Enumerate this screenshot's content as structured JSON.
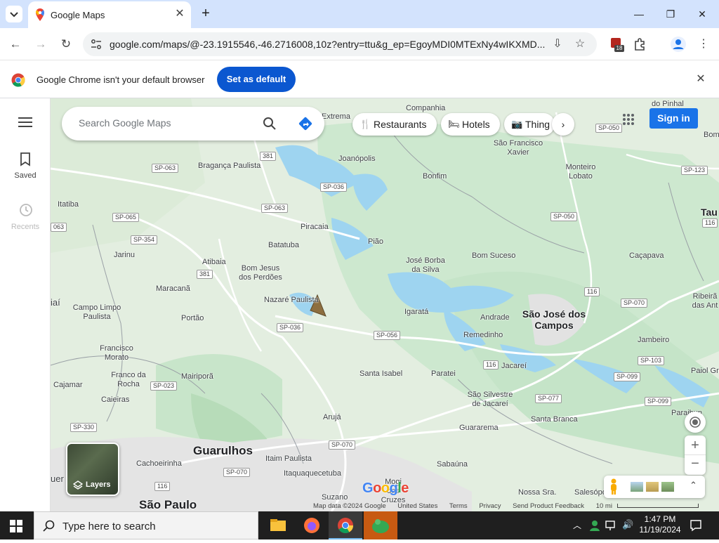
{
  "browser": {
    "tab_title": "Google Maps",
    "url": "google.com/maps/@-23.1915546,-46.2716008,10z?entry=ttu&g_ep=EgoyMDI0MTExNy4wIKXMD...",
    "extension_badge": "18",
    "infobar_message": "Google Chrome isn't your default browser",
    "set_default_label": "Set as default"
  },
  "rail": {
    "saved_label": "Saved",
    "recents_label": "Recents"
  },
  "maps": {
    "search_placeholder": "Search Google Maps",
    "chips": [
      "Restaurants",
      "Hotels",
      "Thing"
    ],
    "sign_in": "Sign in",
    "layers_label": "Layers",
    "footer": [
      "Map data ©2024 Google",
      "United States",
      "Terms",
      "Privacy",
      "Send Product Feedback",
      "10 mi"
    ],
    "places": {
      "braganca": "Bragança Paulista",
      "joanopolis": "Joanópolis",
      "companhia": "Companhia",
      "extrema": "Extrema",
      "piracaia": "Piracaia",
      "pinhal": "do Pinhal",
      "sao_francisco": "São Francisco Xavier",
      "bonfim": "Bonfim",
      "monteiro": "Monteiro Lobato",
      "itatiba": "Itatiba",
      "jarinu": "Jarinu",
      "atibaia": "Atibaia",
      "batatuba": "Batatuba",
      "bom_jesus": "Bom Jesus dos Perdões",
      "piao": "Pião",
      "jose_borba": "José Borba da Silva",
      "bom_suceso": "Bom Suceso",
      "cacapava": "Caçapava",
      "maracana": "Maracanã",
      "nazare": "Nazaré Paulista",
      "campo_limpo": "Campo Limpo Paulista",
      "portao": "Portão",
      "igarata": "Igaratá",
      "andrade": "Andrade",
      "sjc": "São José dos Campos",
      "remedinho": "Remedinho",
      "jambeiro": "Jambeiro",
      "ribeiras": "Ribeirã das Ant",
      "francisco_morato": "Francisco Morato",
      "franco": "Franco da Rocha",
      "mairipora": "Mairiporã",
      "santa_isabel": "Santa Isabel",
      "paratei": "Paratei",
      "jacarei": "Jacareí",
      "paiol": "Paiol Gr",
      "cajamar": "Cajamar",
      "caieiras": "Caieiras",
      "sao_silvestre": "São Silvestre de Jacareí",
      "paraibuna": "Paraibun",
      "aruja": "Arujá",
      "santa_branca": "Santa Branca",
      "guararema": "Guararema",
      "guarulhos": "Guarulhos",
      "itaim": "Itaim Paulista",
      "cachoeirinha": "Cachoeirinha",
      "itaquaquecetuba": "Itaquaquecetuba",
      "sabauna": "Sabaúna",
      "suzano": "Suzano",
      "mogi": "Mogi das Cruzes",
      "nossa_sra": "Nossa Sra.",
      "salesopolis": "Salesópolis",
      "sao_paulo": "São Paulo",
      "tau": "Tau",
      "bom": "Bom",
      "iai": "iaí",
      "uer": "uer"
    },
    "shields": [
      "381",
      "SP-063",
      "SP-036",
      "SP-063",
      "SP-065",
      "SP-354",
      "381",
      "SP-050",
      "SP-050",
      "SP-123",
      "116",
      "SP-036",
      "SP-056",
      "116",
      "SP-070",
      "SP-103",
      "SP-099",
      "SP-099",
      "SP-023",
      "SP-077",
      "SP-330",
      "SP-070",
      "SP-070",
      "116",
      "116",
      "063"
    ]
  },
  "taskbar": {
    "search_placeholder": "Type here to search",
    "time": "1:47 PM",
    "date": "11/19/2024"
  },
  "colors": {
    "accent": "#1a73e8",
    "chrome_frame": "#d3e3fd",
    "map_green": "#d2ead2",
    "water": "#9ed4f0",
    "road": "#ffffff"
  }
}
